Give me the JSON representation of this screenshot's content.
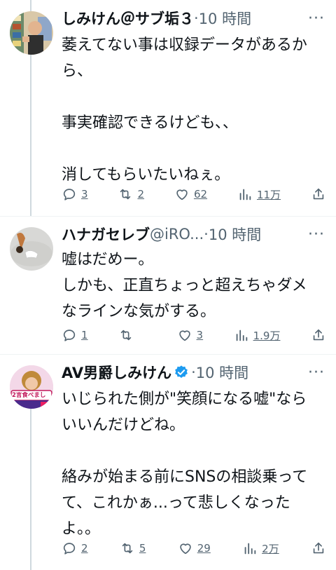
{
  "tweets": [
    {
      "name": "しみけん＠サブ垢３",
      "handle": "",
      "sep": "·",
      "time": "10 時間",
      "body": "萎えてない事は収録データがあるから、\n\n事実確認できるけども、、\n\n消してもらいたいねぇ。",
      "replies": "3",
      "retweets": "2",
      "likes": "62",
      "views": "11万"
    },
    {
      "name": "ハナガセレブ",
      "handle": " @iRO...",
      "sep": "·",
      "time": "10 時間",
      "body": "嘘はだめー。\nしかも、正直ちょっと超えちゃダメなラインな気がする。",
      "replies": "1",
      "retweets": "",
      "likes": "3",
      "views": "1.9万"
    },
    {
      "name": "AV男爵しみけん",
      "handle": "",
      "sep": "·",
      "time": "10 時間",
      "body": "いじられた側が\"笑顔になる嘘\"ならいいんだけどね。\n\n絡みが始まる前にSNSの相談乗ってて、これかぁ...って悲しくなったよ。。",
      "replies": "2",
      "retweets": "5",
      "likes": "29",
      "views": "2万",
      "avatar_text": "2言食べまし"
    }
  ],
  "icons": {
    "reply": "reply-icon",
    "retweet": "retweet-icon",
    "like": "heart-icon",
    "views": "views-icon",
    "share": "share-icon",
    "more": "more-icon",
    "verified": "verified-badge-icon"
  },
  "colors": {
    "text": "#0f1419",
    "secondary": "#536471",
    "verified": "#1d9bf0",
    "thread_line": "#cfd9de"
  }
}
